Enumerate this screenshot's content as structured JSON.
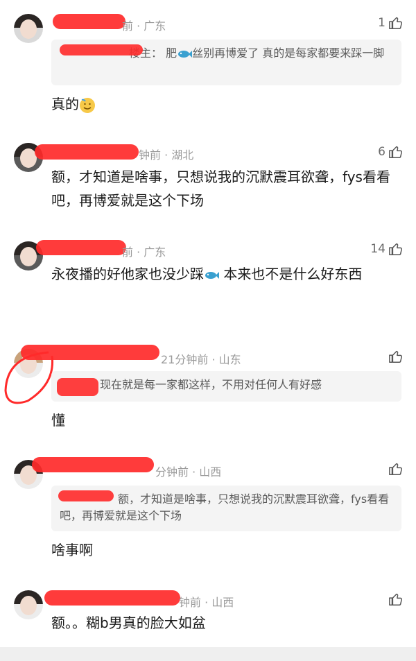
{
  "comments": [
    {
      "meta": "前 · 广东",
      "likes": "1",
      "quote_prefix": "楼主：",
      "quote_text": "肥",
      "quote_text2": "丝别再博爱了 真的是每家都要来踩一脚",
      "text": "真的"
    },
    {
      "meta": "钟前 · 湖北",
      "likes": "6",
      "text": "额，才知道是啥事，只想说我的沉默震耳欲聋，fys看看吧，再博爱就是这个下场"
    },
    {
      "meta": "前 · 广东",
      "likes": "14",
      "text_a": "永夜播的好他家也没少踩",
      "text_b": "本来也不是什么好东西"
    },
    {
      "meta": "21分钟前 · 山东",
      "likes": "",
      "quote_text": "现在就是每一家都这样，不用对任何人有好感",
      "text": "懂"
    },
    {
      "meta": "分钟前 · 山西",
      "likes": "",
      "quote_text": "额，才知道是啥事，只想说我的沉默震耳欲聋，fys看看吧，再博爱就是这个下场",
      "text": "啥事啊"
    },
    {
      "meta": "钟前 · 山西",
      "likes": "",
      "text": "额。。糊b男真的脸大如盆"
    }
  ],
  "colors": {
    "redaction": "#ff2a2a",
    "meta": "#9a9a9a",
    "quote_bg": "#f4f4f4"
  },
  "icons": {
    "like": "thumbs-up-icon",
    "fish": "fish-emoji-icon",
    "sweat": "sweat-smile-emoji-icon"
  }
}
